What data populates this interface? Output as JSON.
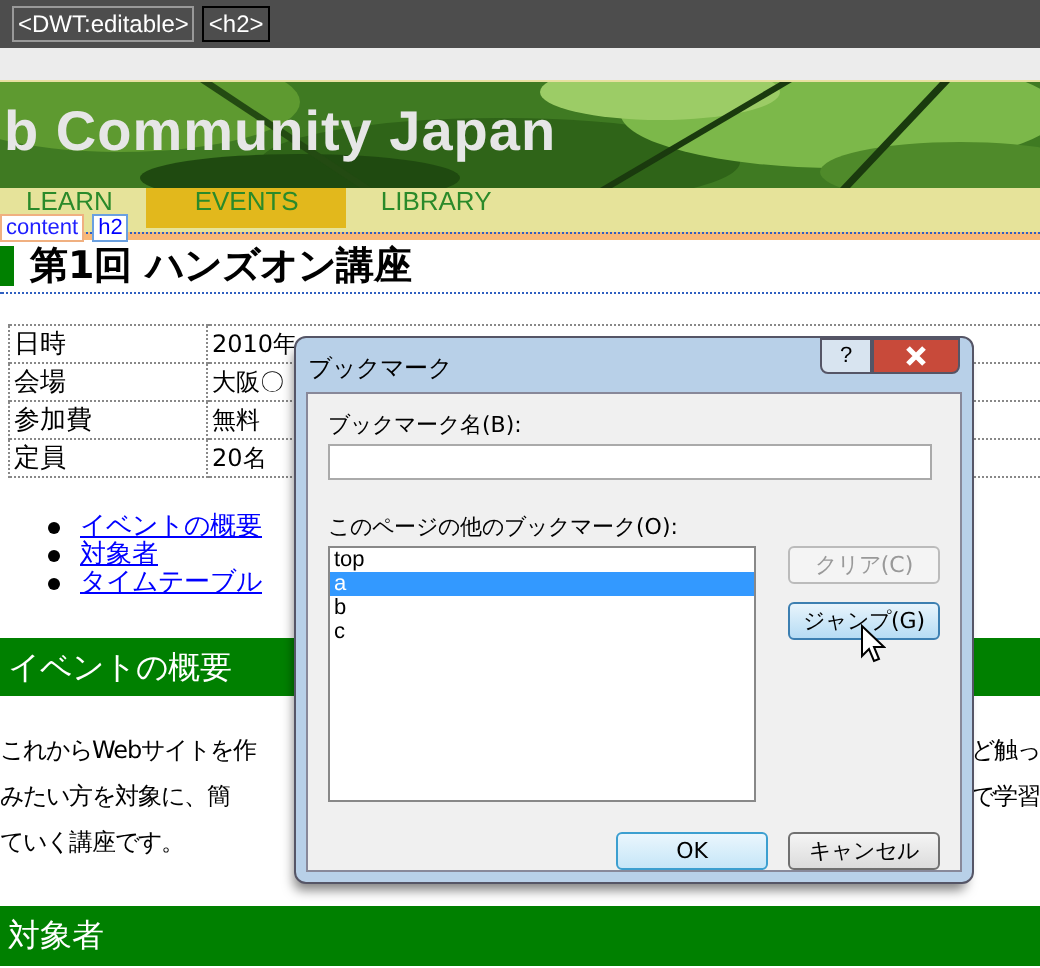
{
  "editor_bar": {
    "tags": [
      {
        "label": "<DWT:editable>",
        "selected": false
      },
      {
        "label": "<h2>",
        "selected": true
      }
    ]
  },
  "banner": {
    "title": "b Community Japan"
  },
  "nav": [
    {
      "label": "LEARN",
      "selected": false
    },
    {
      "label": "EVENTS",
      "selected": true
    },
    {
      "label": "LIBRARY",
      "selected": false
    }
  ],
  "element_labels": [
    "content",
    "h2"
  ],
  "heading": "第1回 ハンズオン講座",
  "info_table": [
    {
      "label": "日時",
      "value": "2010年"
    },
    {
      "label": "会場",
      "value": "大阪〇"
    },
    {
      "label": "参加費",
      "value": "無料"
    },
    {
      "label": "定員",
      "value": "20名"
    }
  ],
  "links": [
    "イベントの概要",
    "対象者",
    "タイムテーブル"
  ],
  "section_1": {
    "title": "イベントの概要",
    "lines": [
      {
        "left": "これからWebサイトを作",
        "right": "ど触っ"
      },
      {
        "left": "みたい方を対象に、簡",
        "right": "で学習"
      },
      {
        "left": "ていく講座です。"
      }
    ]
  },
  "section_2": {
    "title": "対象者"
  },
  "dialog": {
    "title": "ブックマーク",
    "help": "?",
    "name_label": "ブックマーク名(B):",
    "list_label": "このページの他のブックマーク(O):",
    "bookmarks": [
      {
        "label": "top",
        "selected": false
      },
      {
        "label": "a",
        "selected": true
      },
      {
        "label": "b",
        "selected": false
      },
      {
        "label": "c",
        "selected": false
      }
    ],
    "side_buttons": [
      {
        "label": "クリア(C)",
        "disabled": true
      },
      {
        "label": "ジャンプ(G)",
        "disabled": false
      }
    ],
    "buttons": [
      {
        "label": "OK",
        "kind": "default"
      },
      {
        "label": "キャンセル",
        "kind": "normal"
      }
    ]
  }
}
